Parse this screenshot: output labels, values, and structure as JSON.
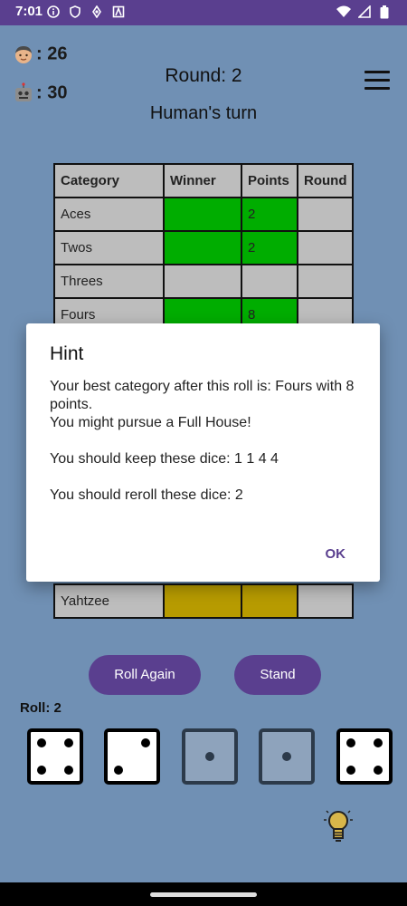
{
  "status_bar": {
    "time": "7:01"
  },
  "scores": {
    "human": {
      "icon": "person-emoji-icon",
      "value": ": 26"
    },
    "computer": {
      "icon": "robot-emoji-icon",
      "value": ": 30"
    }
  },
  "round_label": "Round: 2",
  "turn_label": "Human's turn",
  "table": {
    "headers": [
      "Category",
      "Winner",
      "Points",
      "Round"
    ],
    "rows": [
      {
        "category": "Aces",
        "winner": "",
        "points": "2",
        "round": ""
      },
      {
        "category": "Twos",
        "winner": "",
        "points": "2",
        "round": ""
      },
      {
        "category": "Threes",
        "winner": "",
        "points": "",
        "round": ""
      },
      {
        "category": "Fours",
        "winner": "",
        "points": "8",
        "round": ""
      },
      {
        "category": "Yahtzee",
        "winner": "",
        "points": "",
        "round": ""
      }
    ]
  },
  "dialog": {
    "title": "Hint",
    "line1": "Your best category after this roll is: Fours with 8 points.",
    "line2": "You might pursue a Full House!",
    "line3": "You should keep these dice: 1 1 4 4",
    "line4": "You should reroll these dice: 2",
    "ok_label": "OK"
  },
  "buttons": {
    "roll_again": "Roll Again",
    "stand": "Stand"
  },
  "roll_label": "Roll: 2",
  "dice": [
    {
      "value": 4,
      "held": false
    },
    {
      "value": 2,
      "held": false
    },
    {
      "value": 1,
      "held": true
    },
    {
      "value": 1,
      "held": true
    },
    {
      "value": 4,
      "held": false
    }
  ],
  "colors": {
    "accent": "#5a3f8f",
    "background": "#7090b4",
    "winner_green": "#00ad00",
    "winner_gold": "#b79b00"
  }
}
